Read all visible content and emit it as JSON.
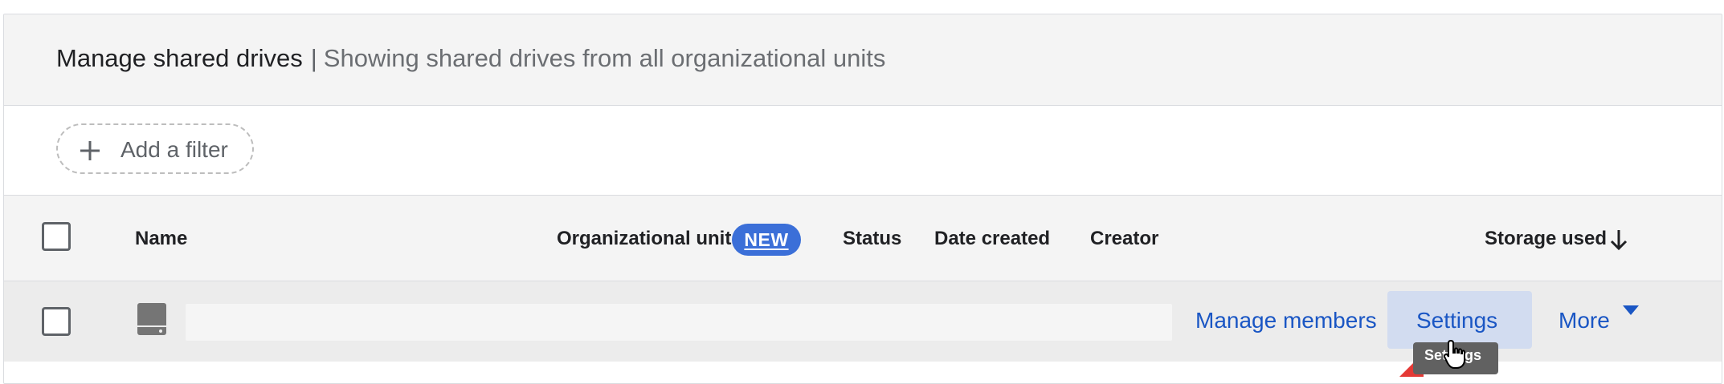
{
  "header": {
    "title": "Manage shared drives",
    "separator": "|",
    "subtitle": "Showing shared drives from all organizational units"
  },
  "filter": {
    "add_filter_label": "Add a filter",
    "icon": "plus-icon"
  },
  "table": {
    "columns": {
      "name": "Name",
      "org_unit": "Organizational unit",
      "new_badge": "NEW",
      "status": "Status",
      "date_created": "Date created",
      "creator": "Creator",
      "storage_used": "Storage used"
    },
    "sort_icon": "arrow-down-icon",
    "rows": [
      {
        "icon": "shared-drive-icon",
        "name": "",
        "actions": {
          "manage_members": "Manage members",
          "settings": "Settings",
          "more": "More"
        }
      }
    ]
  },
  "tooltip": {
    "text": "Settings"
  },
  "colors": {
    "accent": "#1a56c4",
    "badge": "#3b6fd8",
    "header_bg": "#f4f4f4",
    "settings_hover": "#d2dcf0"
  }
}
